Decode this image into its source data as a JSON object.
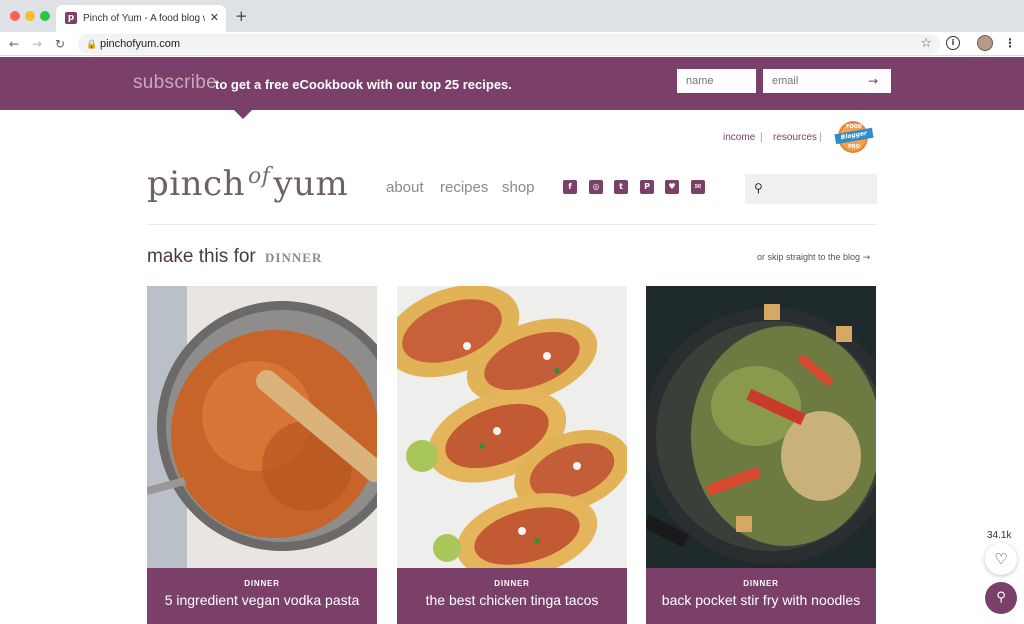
{
  "browser": {
    "tab_title": "Pinch of Yum - A food blog wit",
    "tab_close": "✕",
    "new_tab": "+",
    "url": "pinchofyum.com",
    "favicon_letter": "p",
    "nav_back": "←",
    "nav_forward": "→",
    "nav_reload": "↻",
    "star": "☆",
    "ext_label": "i",
    "menu": "⋮",
    "icons": [
      "back-arrow-icon",
      "forward-arrow-icon",
      "reload-icon",
      "lock-icon",
      "star-icon",
      "extension-icon",
      "profile-icon",
      "menu-icon"
    ]
  },
  "subscribe": {
    "word": "subscribe",
    "text": "to get a free eCookbook with our top 25 recipes.",
    "name_placeholder": "name",
    "email_placeholder": "email",
    "submit_arrow": "→",
    "color": "#7a4069"
  },
  "utility": {
    "income": "income",
    "resources": "resources",
    "separator": "|",
    "badge": {
      "top": "FOOD",
      "ribbon": "Blogger",
      "bottom": "PRO"
    }
  },
  "logo": {
    "pre": "pinch",
    "mid": "of",
    "post": "yum"
  },
  "nav": {
    "about": "about",
    "recipes": "recipes",
    "shop": "shop"
  },
  "social": [
    {
      "name": "facebook-icon",
      "glyph": "f"
    },
    {
      "name": "instagram-icon",
      "glyph": "◎"
    },
    {
      "name": "twitter-icon",
      "glyph": "t"
    },
    {
      "name": "pinterest-icon",
      "glyph": "P"
    },
    {
      "name": "heart-icon",
      "glyph": "♥"
    },
    {
      "name": "mail-icon",
      "glyph": "✉"
    }
  ],
  "search": {
    "glyph": "⚲",
    "placeholder": ""
  },
  "section": {
    "title": "make this for",
    "category": "DINNER",
    "skip_text": "or skip straight to the blog",
    "skip_arrow": "→"
  },
  "cards": [
    {
      "category": "DINNER",
      "title": "5 ingredient vegan vodka pasta"
    },
    {
      "category": "DINNER",
      "title": "the best chicken tinga tacos"
    },
    {
      "category": "DINNER",
      "title": "back pocket stir fry with noodles"
    }
  ],
  "floating": {
    "save_count": "34.1k",
    "heart": "♡",
    "search": "⚲"
  }
}
